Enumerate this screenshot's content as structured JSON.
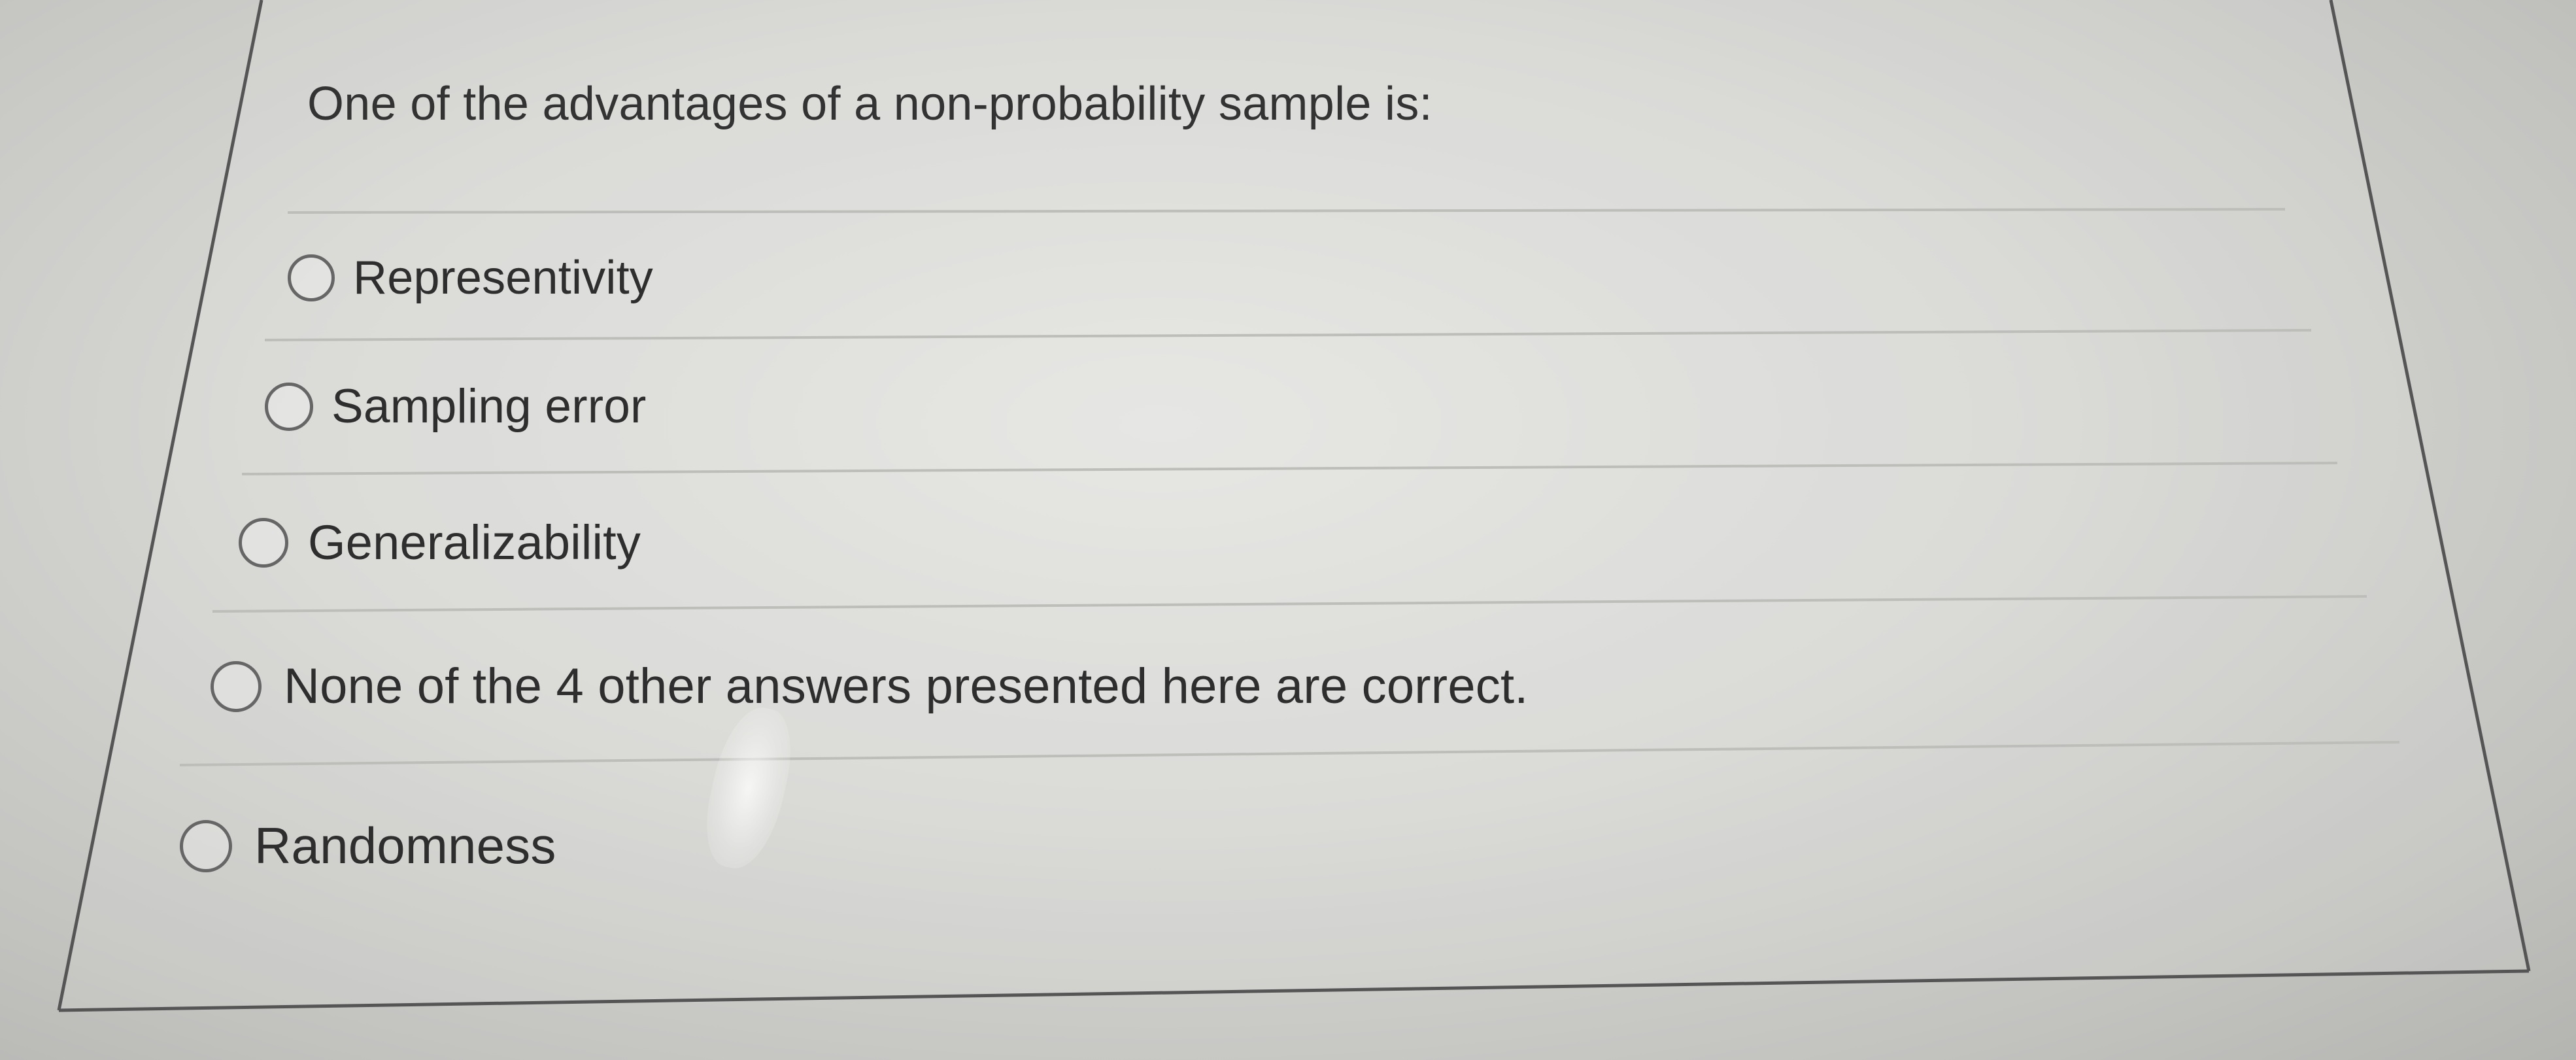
{
  "question": {
    "text": "One of the advantages of a non-probability sample is:"
  },
  "options": [
    {
      "label": "Representivity",
      "selected": false
    },
    {
      "label": "Sampling error",
      "selected": false
    },
    {
      "label": "Generalizability",
      "selected": false
    },
    {
      "label": "None of the 4 other answers presented here are correct.",
      "selected": false
    },
    {
      "label": "Randomness",
      "selected": false
    }
  ],
  "colors": {
    "text": "#333333",
    "radio_border": "#666666",
    "card_border": "#555555",
    "divider": "#bdbdb9"
  },
  "icons": {
    "option_marker": "radio-button-icon"
  }
}
